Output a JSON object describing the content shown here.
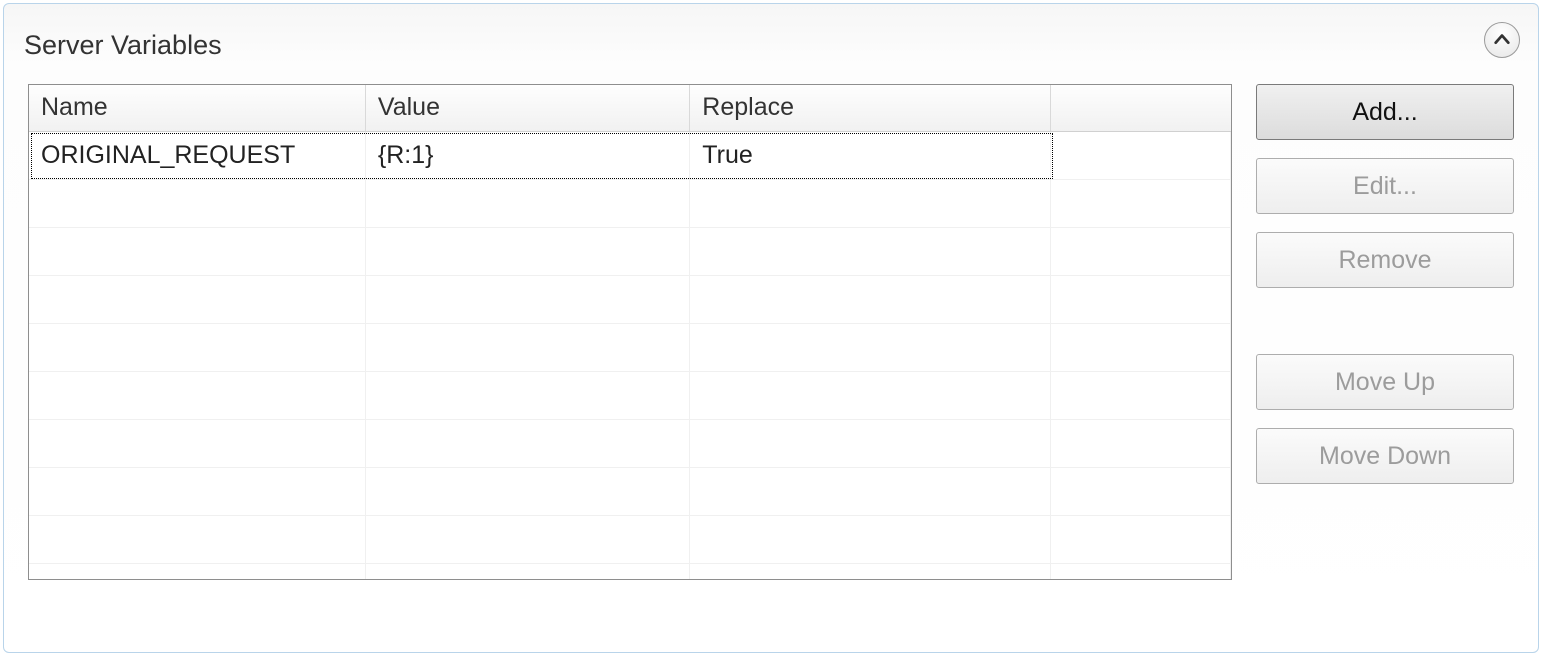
{
  "panel": {
    "title": "Server Variables"
  },
  "columns": {
    "name": "Name",
    "value": "Value",
    "replace": "Replace"
  },
  "rows": [
    {
      "name": "ORIGINAL_REQUEST",
      "value": "{R:1}",
      "replace": "True"
    }
  ],
  "buttons": {
    "add": "Add...",
    "edit": "Edit...",
    "remove": "Remove",
    "move_up": "Move Up",
    "move_down": "Move Down"
  }
}
